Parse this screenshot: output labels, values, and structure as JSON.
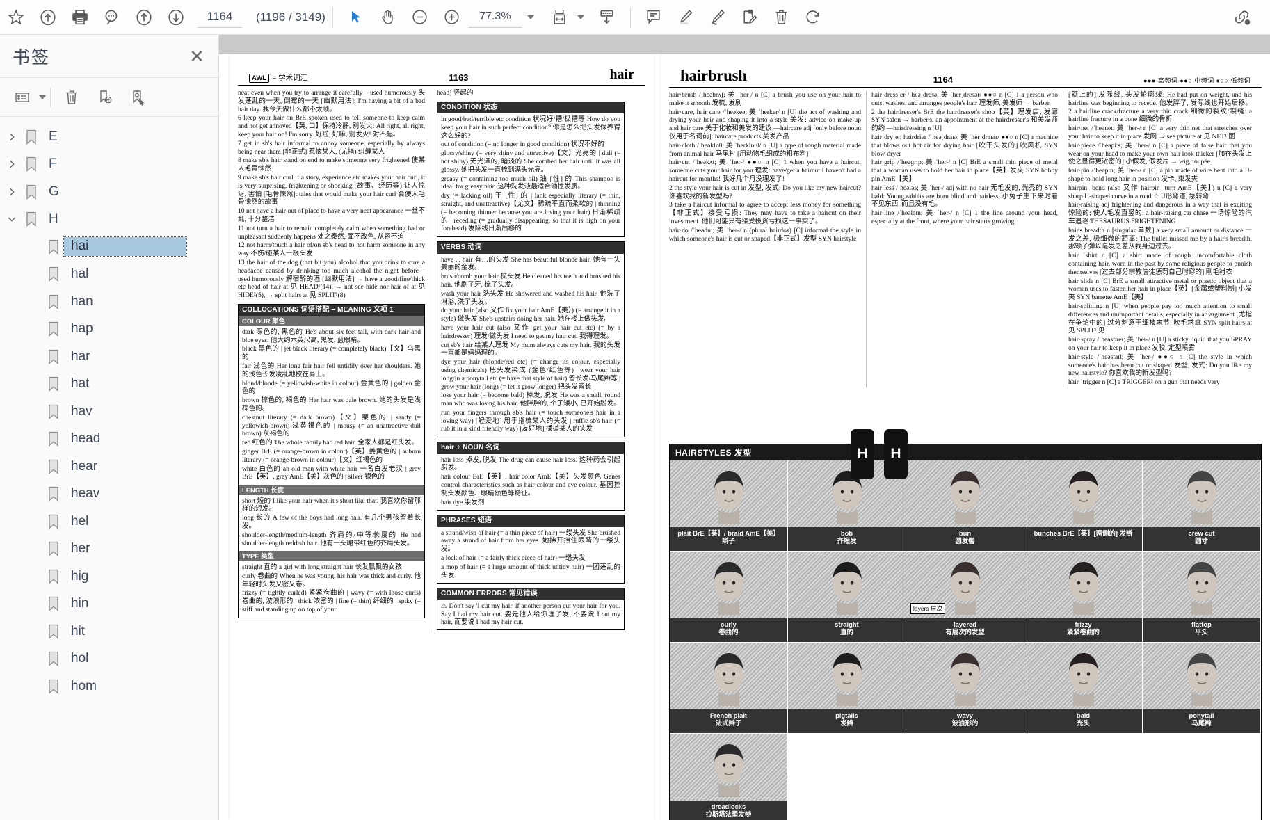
{
  "toolbar": {
    "icons_left": [
      {
        "name": "bookmark-star-icon",
        "title": "Add bookmark"
      },
      {
        "name": "cloud-upload-icon",
        "title": "Upload"
      },
      {
        "name": "print-icon",
        "title": "Print"
      },
      {
        "name": "search-icon",
        "title": "Search"
      },
      {
        "name": "previous-page-icon",
        "title": "Previous page"
      },
      {
        "name": "next-page-icon",
        "title": "Next page"
      }
    ],
    "page_number": "1164",
    "page_total": "(1196 / 3149)",
    "tools": [
      {
        "name": "select-tool-icon",
        "title": "Select",
        "active": true
      },
      {
        "name": "hand-tool-icon",
        "title": "Pan"
      },
      {
        "name": "zoom-out-icon",
        "title": "Zoom out"
      },
      {
        "name": "zoom-in-icon",
        "title": "Zoom in"
      }
    ],
    "zoom_level": "77.3%",
    "icons_right": [
      {
        "name": "fit-width-icon",
        "title": "Fit width"
      },
      {
        "name": "scroll-mode-icon",
        "title": "Page layout"
      },
      {
        "name": "comment-icon",
        "title": "Comment"
      },
      {
        "name": "highlight-icon",
        "title": "Highlight"
      },
      {
        "name": "ink-pen-icon",
        "title": "Freehand"
      },
      {
        "name": "stamp-edit-icon",
        "title": "Annotate"
      },
      {
        "name": "delete-icon",
        "title": "Delete"
      },
      {
        "name": "rotate-icon",
        "title": "Rotate"
      },
      {
        "name": "link-icon",
        "title": "Link"
      }
    ]
  },
  "sidebar": {
    "title": "书签",
    "close_label": "✕",
    "tools": [
      {
        "name": "list-options-icon",
        "title": "Options"
      },
      {
        "name": "delete-bookmark-icon",
        "title": "Delete bookmark"
      },
      {
        "name": "add-bookmark-icon",
        "title": "Add bookmark"
      },
      {
        "name": "locate-bookmark-icon",
        "title": "Locate bookmark"
      }
    ],
    "items": [
      {
        "label": "E",
        "level": 0,
        "expanded": false,
        "selected": false
      },
      {
        "label": "F",
        "level": 0,
        "expanded": false,
        "selected": false
      },
      {
        "label": "G",
        "level": 0,
        "expanded": false,
        "selected": false
      },
      {
        "label": "H",
        "level": 0,
        "expanded": true,
        "selected": false
      },
      {
        "label": "hai",
        "level": 1,
        "expanded": null,
        "selected": true
      },
      {
        "label": "hal",
        "level": 1,
        "expanded": null,
        "selected": false
      },
      {
        "label": "han",
        "level": 1,
        "expanded": null,
        "selected": false
      },
      {
        "label": "hap",
        "level": 1,
        "expanded": null,
        "selected": false
      },
      {
        "label": "har",
        "level": 1,
        "expanded": null,
        "selected": false
      },
      {
        "label": "hat",
        "level": 1,
        "expanded": null,
        "selected": false
      },
      {
        "label": "hav",
        "level": 1,
        "expanded": null,
        "selected": false
      },
      {
        "label": "head",
        "level": 1,
        "expanded": null,
        "selected": false
      },
      {
        "label": "hear",
        "level": 1,
        "expanded": null,
        "selected": false
      },
      {
        "label": "heav",
        "level": 1,
        "expanded": null,
        "selected": false
      },
      {
        "label": "hel",
        "level": 1,
        "expanded": null,
        "selected": false
      },
      {
        "label": "her",
        "level": 1,
        "expanded": null,
        "selected": false
      },
      {
        "label": "hig",
        "level": 1,
        "expanded": null,
        "selected": false
      },
      {
        "label": "hin",
        "level": 1,
        "expanded": null,
        "selected": false
      },
      {
        "label": "hit",
        "level": 1,
        "expanded": null,
        "selected": false
      },
      {
        "label": "hol",
        "level": 1,
        "expanded": null,
        "selected": false
      },
      {
        "label": "hom",
        "level": 1,
        "expanded": null,
        "selected": false
      }
    ]
  },
  "left_page": {
    "awl_tag": "AWL",
    "awl_note": "= 学术词汇",
    "page_number": "1163",
    "running_head": "hair",
    "col1": {
      "p1": "neat even when you try to arrange it carefully – used humorously 头发蓬乱的一天, 倒霉的一天 [幽默用法]: I'm having a bit of a bad hair day. 我今天做什么都不太顺。",
      "p2": "6 keep your hair on BrE spoken used to tell someone to keep calm and not get annoyed【英, 口】保持冷静, 别发火: All right, all right, keep your hair on! I'm sorry. 好啦, 好嘛, 别发火! 对不起。",
      "p3": "7 get in sb's hair informal to annoy someone, especially by always being near them [非正式] 惹恼某人, (尤指) 纠缠某人",
      "p4": "8 make sb's hair stand on end to make someone very frightened 使某人毛骨悚然",
      "p5": "9 make sb's hair curl if a story, experience etc makes your hair curl, it is very surprising, frightening or shocking (故事、经历等) 让人惊讶, 害怕 [毛骨悚然]: tales that would make your hair curl 会使人毛骨悚然的故事",
      "p6": "10 not have a hair out of place to have a very neat appearance 一丝不乱, 十分整洁",
      "p7": "11 not turn a hair to remain completely calm when something bad or unpleasant suddenly happens 处之泰然, 面不改色, 从容不迫",
      "p8": "12 not harm/touch a hair of/on sb's head to not harm someone in any way 不伤/碰某人一根头发",
      "p9": "13 the hair of the dog (that bit you) alcohol that you drink to cure a headache caused by drinking too much alcohol the night before – used humorously 解宿醉的酒 [幽默用法] → have a good/fine/thick etc head of hair at 见 HEAD¹(14), → not see hide nor hair of at 见 HIDE²(5), → split hairs at 见 SPLIT¹(8)",
      "collocations": {
        "bar": "COLLOCATIONS 词语搭配 – MEANING 义项 1",
        "subbar": "COLOUR 颜色",
        "entries": [
          "dark 深色的, 黑色的 He's about six feet tall, with dark hair and blue eyes. 他大约六英尺高, 黑发, 蓝眼睛。",
          "black 黑色的 | jet black literary (= completely black)【文】乌黑的",
          "fair 浅色的 Her long fair hair fell untidily over her shoulders. 她的浅色长发凌乱地披在肩上。",
          "blond/blonde (= yellowish-white in colour) 金黄色的 | golden 金色的",
          "brown 棕色的, 褐色的 Her hair was pale brown. 她的头发是浅棕色的。",
          "chestnut literary (= dark brown)【文】栗色的 | sandy (= yellowish-brown) 浅黄褐色的 | mousy (= an unattractive dull brown) 灰褐色的",
          "red 红色的 The whole family had red hair. 全家人都是红头发。",
          "ginger BrE (= orange-brown in colour)【英】姜黄色的 | auburn literary (= orange-brown in colour)【文】红褐色的",
          "white 白色的 an old man with white hair 一名白发老汉 | grey BrE【英】, gray AmE【美】灰色的 | silver 银色的"
        ],
        "subbar2": "LENGTH 长度",
        "entries2": [
          "short 短的 I like your hair when it's short like that. 我喜欢你留那样的短发。",
          "long 长的 A few of the boys had long hair. 有几个男孩留着长发。",
          "shoulder-length/medium-length 齐肩的/中等长度的 He had shoulder-length reddish hair. 他有一头略带红色的齐肩头发。"
        ],
        "subbar3": "TYPE 类型",
        "entries3": [
          "straight 直的 a girl with long straight hair 长发飘飘的女孩",
          "curly 卷曲的 When he was young, his hair was thick and curly. 他年轻时头发又密又卷。",
          "frizzy (= tightly curled) 紧紧卷曲的 | wavy (= with loose curls) 卷曲的, 波浪形的 | thick 浓密的 | fine (= thin) 纤细的 | spiky (= stiff and standing up on top of your"
        ]
      }
    },
    "col2": {
      "p0": "head) 竖起的",
      "condition": {
        "bar": "CONDITION 状态",
        "entries": [
          "in good/bad/terrible etc condition 状况好/糟/极糟等 How do you keep your hair in such perfect condition? 你是怎么把头发保养得这么好的?",
          "out of condition (= no longer in good condition) 状况不好的",
          "glossy/shiny (= very shiny and attractive)【文】光亮的 | dull (= not shiny) 无光泽的, 暗淡的 She combed her hair until it was all glossy. 她把头发一直梳到满头光亮。",
          "greasy (= containing too much oil) 油 [性] 的 This shampoo is ideal for greasy hair. 这种洗发液最适合油性发质。",
          "dry (= lacking oil) 干 [性] 的 | lank especially literary (= thin, straight, and unattractive)【尤文】稀疏平直而柔软的 | thinning (= becoming thinner because you are losing your hair) 日渐稀疏的 | receding (= gradually disappearing, so that it is high on your forehead) 发际线日渐后移的"
        ]
      },
      "verbs": {
        "bar": "VERBS 动词",
        "entries": [
          "have ... hair 有…的头发 She has beautiful blonde hair. 她有一头美丽的金发。",
          "brush/comb your hair 梳头发 He cleaned his teeth and brushed his hair. 他刷了牙, 梳了头发。",
          "wash your hair 洗头发 He showered and washed his hair. 他洗了淋浴, 洗了头发。",
          "do your hair (also 又作 fix your hair AmE【美】) (= arrange it in a style) 做头发 She's upstairs doing her hair. 她在楼上做头发。",
          "have your hair cut (also 又作 get your hair cut etc) (= by a hairdresser) 理发/做头发 I need to get my hair cut. 我得理发。",
          "cut sb's hair 给某人理发 My mum always cuts my hair. 我的头发一直都是妈妈理的。",
          "dye your hair (blonde/red etc) (= change its colour, especially using chemicals) 把头发染成 (金色/红色等) | wear your hair long/in a ponytail etc (= have that style of hair) 留长发/马尾辫等 | grow your hair (long) (= let it grow longer) 把头发留长",
          "lose your hair (= become bald) 掉发, 脱发 He was a small, round man who was losing his hair. 他胖胖的, 个子矮小, 已开始脱发。",
          "run your fingers through sb's hair (= touch someone's hair in a loving way) [轻爱地] 用手指梳某人的头发 | ruffle sb's hair (= rub it in a kind friendly way) [友好地] 揉搓某人的头发"
        ]
      },
      "hairnoun": {
        "bar": "hair + NOUN 名词",
        "entries": [
          "hair loss 掉发, 脱发 The drug can cause hair loss. 这种药会引起脱发。",
          "hair colour BrE【英】, hair color AmE【美】头发颜色 Genes control characteristics such as hair colour and eye colour. 基因控制头发颜色、眼睛颜色等特征。",
          "hair dye 染发剂"
        ]
      },
      "phrases": {
        "bar": "PHRASES 短语",
        "entries": [
          "a strand/wisp of hair (= a thin piece of hair) 一缕头发 She brushed away a strand of hair from her eyes. 她拂开挡住眼睛的一缕头发。",
          "a lock of hair (= a fairly thick piece of hair) 一绺头发",
          "a mop of hair (= a large amount of thick untidy hair) 一团蓬乱的头发"
        ]
      },
      "errors": {
        "bar": "COMMON ERRORS 常见错误",
        "text": "⚠ Don't say 'I cut my hair' if another person cut your hair for you. Say I had my hair cut. 要是他人给你理了发, 不要说 I cut my hair, 而要说 I had my hair cut."
      }
    }
  },
  "right_page": {
    "running_head": "hairbrush",
    "page_number": "1164",
    "freq_legend": "●●● 高频词  ●●○ 中频词  ●○○ 低频词",
    "col1": [
      "hair·brush /ˈheəbrʌʃ; 美 ˈher-/ n [C] a brush you use on your hair to make it smooth 发梳, 发刷",
      "hair·care, hair care /ˈheəkeə; 美 ˈherker/ n [U] the act of washing and drying your hair and shaping it into a style 美发: advice on make-up and hair care 关于化妆和美发的建议 —haircare adj [only before noun 仅用于名词前]: haircare products 美发产品",
      "hair·cloth /ˈheəklɒθ; 美 ˈherklɒːθ/ n [U] a type of rough material made from animal hair 马尾衬 [用动物毛织成的粗布料]",
      "hair·cut /ˈheəkʌt; 美 ˈher-/ ●●○ n [C] 1 when you have a haircut, someone cuts your hair for you 理发: have/get a haircut I haven't had a haircut for months! 我好几个月没理发了!",
      "2 the style your hair is cut in 发型, 发式: Do you like my new haircut? 你喜欢我的新发型吗?",
      "3 take a haircut informal to agree to accept less money for something【非正式】接受亏损: They may have to take a haircut on their investment. 他们可能只有接受投资亏损这一事实了。",
      "hair·do /ˈheəduː; 美 ˈher-/ n (plural hairdos) [C] informal the style in which someone's hair is cut or shaped【非正式】发型 SYN hairstyle",
      "hair·dress·er /ˈheəˌdresə; 美 ˈherˌdresər/ ●●○ n [C] 1 a person who cuts, washes, and arranges people's hair 理发师, 美发师 → barber",
      "2 the hairdresser's BrE the hairdresser's shop【英】理发店, 发廊 SYN salon → barber's: an appointment at the hairdresser's 和美发师的约 —hairdressing n [U]",
      "hair·dry·er, hairdrier /ˈheəˌdraɪə; 美 ˈherˌdraɪər/ ●●○ n [C] a machine that blows out hot air for drying hair [吹干头发的] 吹风机 SYN blow-dryer",
      "hair·grip /ˈheəɡrɪp; 美 ˈher-/ n [C] BrE a small thin piece of metal that a woman uses to hold her hair in place【英】发夹 SYN bobby pin AmE【美】",
      "hair·less /ˈheələs; 美 ˈher-/ adj with no hair 无毛发的, 光秃的 SYN bald: Young rabbits are born blind and hairless. 小兔子生下来时看不见东西, 而且没有毛。",
      "hair·line /ˈheəlaɪn; 美 ˈher-/ n [C] 1 the line around your head, especially at the front, where your hair starts growing"
    ],
    "col3": [
      "[额上的] 发际线, 头发轮廓线: He had put on weight, and his hairline was beginning to recede. 他发胖了, 发际线也开始后移。 2 a hairline crack/fracture a very thin crack 细微的裂纹/裂缝: a hairline fracture in a bone 细微的骨折",
      "hair·net /ˈheənet; 美 ˈher-/ n [C] a very thin net that stretches over your hair to keep it in place 发网 → see picture at 见 NET¹ 图",
      "hair·piece /ˈheəpiːs; 美 ˈher-/ n [C] a piece of false hair that you wear on your head to make your own hair look thicker [加在头发上使之显得更浓密的] 小假发, 假发片 → wig, toupée",
      "hair·pin /ˈheəpɪn; 美 ˈher-/ n [C] a pin made of wire bent into a U-shape to hold long hair in position 发卡, 束发夹",
      "hairpin ˈbend (also 又作 hairpin ˈturn AmE【美】) n [C] a very sharp U-shaped curve in a road ☆ U形弯道, 急转弯",
      "hair-raising adj frightening and dangerous in a way that is exciting 惊险的; 使人毛发直竖的: a hair-raising car chase 一场惊险的汽车追逐 THESAURUS FRIGHTENING",
      "hair's breadth n [singular 单数] a very small amount or distance 一发之差, 极细微的距离: The bullet missed me by a hair's breadth. 那颗子弹以毫发之差从我身边过去。",
      "hair ˈshirt n [C] a shirt made of rough uncomfortable cloth containing hair, worn in the past by some religious people to punish themselves [过去部分宗教信徒惩罚自己时穿的] 刚毛衬衣",
      "hair slide n [C] BrE a small attractive metal or plastic object that a woman uses to fasten her hair in place【英】[金属或塑料制] 小发夹 SYN barrette AmE【美】",
      "hair-splitting n [U] when people pay too much attention to small differences and unimportant details, especially in an argument [尤指在争论中的] 过分刻意于细枝末节, 吹毛求疵 SYN split hairs at 见 SPLIT¹ 见",
      "hair·spray /ˈheəspreɪ; 美 ˈher-/ n [U] a sticky liquid that you SPRAY on your hair to keep it in place 发胶, 定型喷雾",
      "hair·style /ˈheəstaɪl; 美 ˈher-/ ●●○ n [C] the style in which someone's hair has been cut or shaped 发型, 发式: Do you like my new hairstyle? 你喜欢我的新发型吗?",
      "hair ˈtrigger n [C] a TRIGGER² on a gun that needs very"
    ],
    "hairstyles": {
      "title": "HAIRSTYLES 发型",
      "annotation": "layers 层次",
      "cells": [
        {
          "en": "plait BrE【英】/ braid AmE【美】",
          "cn": "辫子"
        },
        {
          "en": "bob",
          "cn": "齐短发"
        },
        {
          "en": "bun",
          "cn": "圆发髻"
        },
        {
          "en": "bunches BrE【英】[两侧的] 发辫",
          "cn": ""
        },
        {
          "en": "crew cut",
          "cn": "圆寸"
        },
        {
          "en": "curly",
          "cn": "卷曲的"
        },
        {
          "en": "straight",
          "cn": "直的"
        },
        {
          "en": "layered",
          "cn": "有层次的发型"
        },
        {
          "en": "frizzy",
          "cn": "紧紧卷曲的"
        },
        {
          "en": "flattop",
          "cn": "平头"
        },
        {
          "en": "French plait",
          "cn": "法式辫子"
        },
        {
          "en": "pigtails",
          "cn": "发辫"
        },
        {
          "en": "wavy",
          "cn": "波浪形的"
        },
        {
          "en": "bald",
          "cn": "光头"
        },
        {
          "en": "ponytail",
          "cn": "马尾辫"
        },
        {
          "en": "dreadlocks",
          "cn": "拉斯塔法里发辫"
        }
      ]
    }
  },
  "edge_tabs": {
    "left": "H",
    "right": "H"
  }
}
